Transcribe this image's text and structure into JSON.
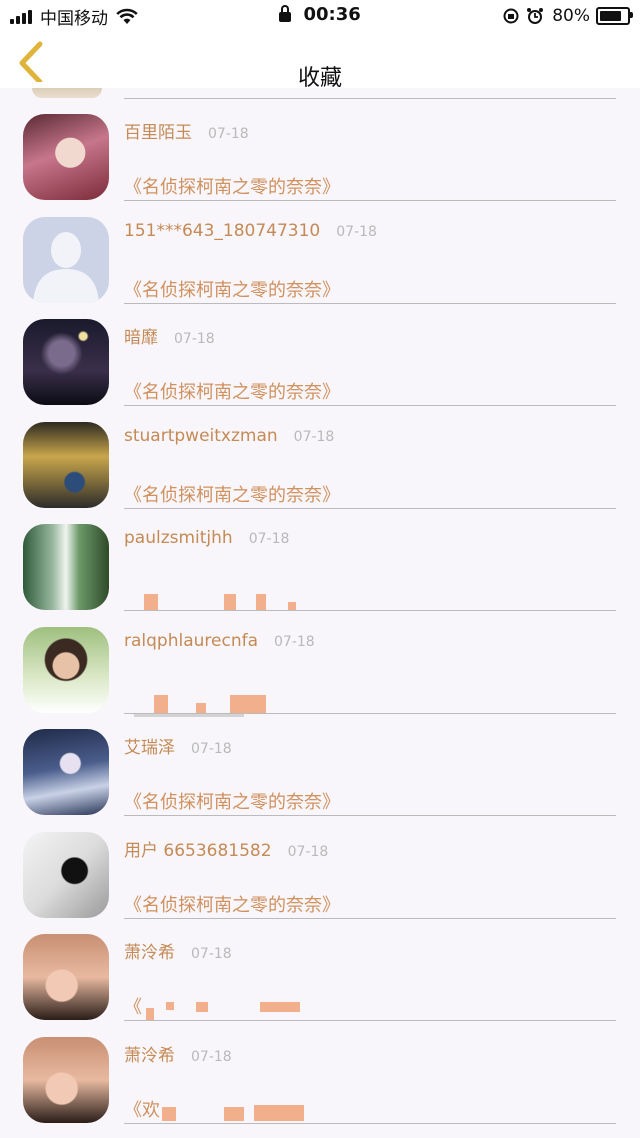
{
  "status_bar": {
    "carrier": "中国移动",
    "time": "00:36",
    "battery_percent": "80%"
  },
  "nav": {
    "title": "收藏",
    "back_icon": "chevron-left-icon",
    "accent_color": "#e0b43a"
  },
  "items": [
    {
      "name": "百里陌玉",
      "date": "07-18",
      "quote": "《名侦探柯南之零的奈奈》",
      "avatar": "anime-girl-avatar"
    },
    {
      "name": "151***643_180747310",
      "date": "07-18",
      "quote": "《名侦探柯南之零的奈奈》",
      "avatar": "default-user-avatar"
    },
    {
      "name": "暗靡",
      "date": "07-18",
      "quote": "《名侦探柯南之零的奈奈》",
      "avatar": "dark-figure-avatar"
    },
    {
      "name": "stuartpweitxzman",
      "date": "07-18",
      "quote": "《名侦探柯南之零的奈奈》",
      "avatar": "street-photo-avatar"
    },
    {
      "name": "paulzsmitjhh",
      "date": "07-18",
      "quote": "",
      "avatar": "waterfall-avatar"
    },
    {
      "name": "ralqphlaurecnfa",
      "date": "07-18",
      "quote": "",
      "avatar": "woman-photo-avatar"
    },
    {
      "name": "艾瑞泽",
      "date": "07-18",
      "quote": "《名侦探柯南之零的奈奈》",
      "avatar": "elf-character-avatar"
    },
    {
      "name": "用户 6653681582",
      "date": "07-18",
      "quote": "《名侦探柯南之零的奈奈》",
      "avatar": "manga-character-avatar"
    },
    {
      "name": "萧泠希",
      "date": "07-18",
      "quote": "《",
      "avatar": "selfie-girl-avatar"
    },
    {
      "name": "萧泠希",
      "date": "07-18",
      "quote": "《欢",
      "avatar": "selfie-girl-avatar"
    }
  ]
}
